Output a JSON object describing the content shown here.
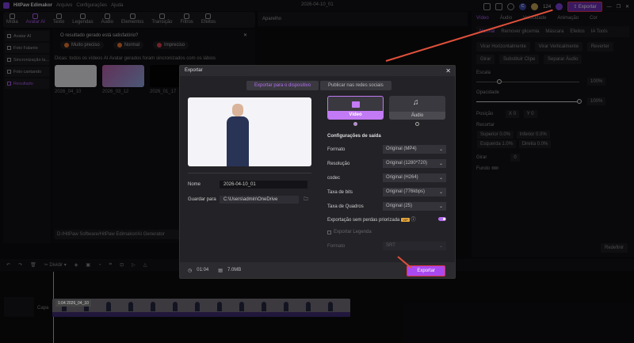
{
  "app": {
    "title": "HitPaw Edimakor",
    "menu": [
      "Arquivo",
      "Configurações",
      "Ajuda"
    ],
    "project_date": "2026-04-10_01",
    "credits": "124",
    "avatar_initial": "C",
    "export_label": "Exportar"
  },
  "toolbar_tabs": [
    "Mídia",
    "Avatar AI",
    "Texto",
    "Legendas",
    "Áudio",
    "Elementos",
    "Transição",
    "Filtros",
    "Efeitos"
  ],
  "sidebar": [
    "Avatar AI",
    "Foto Falante",
    "Sincronização la...",
    "Foto cantando",
    "Resultado"
  ],
  "feedback": {
    "question": "O resultado gerado está satisfatório?",
    "options": [
      "Muito preciso",
      "Normal",
      "Impreciso"
    ],
    "tip": "Dicas: todos os vídeos AI Avatar gerados foram sincronizados com os lábios"
  },
  "results": [
    "2026_04_10",
    "2026_03_12",
    "2026_01_17"
  ],
  "output_path": "D:/HitPaw Software/HitPaw Edimakor/AI Generator",
  "preview": {
    "title": "Aparelho"
  },
  "right_panel": {
    "tabs": [
      "Vídeo",
      "Áudio",
      "Velocidade",
      "Animação",
      "Cor"
    ],
    "subtabs": [
      "Normal",
      "Remover glicemia",
      "Máscara",
      "Efeitos",
      "IA Tools"
    ],
    "buttons": [
      "Virar Horizontalmente",
      "Virar Verticalmente",
      "Reverter",
      "Girar",
      "Substituir Clipe",
      "Separar Áudio"
    ],
    "scale_label": "Escala",
    "scale": "100%",
    "opacity_label": "Opacidade",
    "opacity": "100%",
    "position_label": "Posição",
    "x": "0",
    "y": "0",
    "crop_label": "Recortar",
    "crop": [
      "Superior 0.0%",
      "Inferior 0.0%",
      "Esquerda 1.0%",
      "Direita 0.0%"
    ],
    "rotate_label": "Girar",
    "rotate": "0",
    "bg_label": "Fundo",
    "reset": "Redefinir"
  },
  "timeline": {
    "split": "Dividir",
    "clip_label": "1:04 2026_04_10",
    "track_label": "Capa"
  },
  "dialog": {
    "title": "Exportar",
    "tabs": [
      "Exportar para o dispositivo",
      "Publicar nas redes sociais"
    ],
    "name_label": "Nome",
    "name": "2026-04-10_01",
    "save_label": "Guardar para",
    "save_path": "C:\\Users\\admin\\OneDrive",
    "types": [
      "Vídeo",
      "Áudio"
    ],
    "settings_title": "Configurações de saída",
    "settings": [
      {
        "label": "Formato",
        "value": "Original (MP4)"
      },
      {
        "label": "Resolução",
        "value": "Original (1280*720)"
      },
      {
        "label": "codec",
        "value": "Original (H264)"
      },
      {
        "label": "Taxa de bits",
        "value": "Original (776kbps)"
      },
      {
        "label": "Taxa de Quadros",
        "value": "Original (25)"
      }
    ],
    "lossless_label": "Exportação sem perdas priorizada",
    "vip": "VIP",
    "subtitle_label": "Exportar Legenda",
    "subtitle_format_label": "Formato",
    "subtitle_format": "SRT",
    "duration": "01:04",
    "size": "7.0MB",
    "export_button": "Exportar"
  }
}
